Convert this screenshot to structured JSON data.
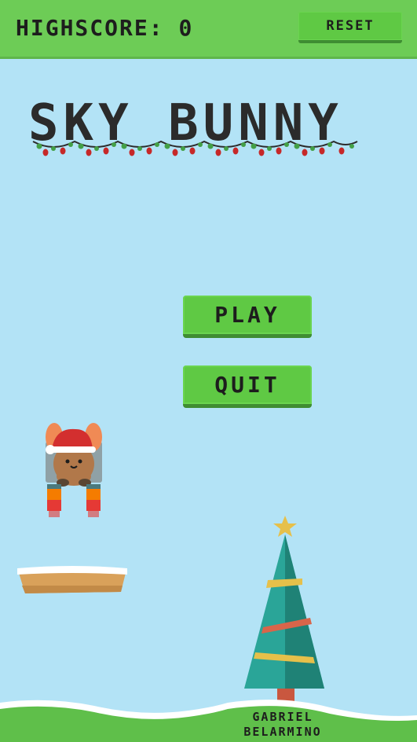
{
  "header": {
    "highscore_label": "HIGHSCORE:",
    "highscore_value": "0",
    "reset_label": "RESET"
  },
  "title": "SKY BUNNY",
  "menu": {
    "play_label": "PLAY",
    "quit_label": "QUIT"
  },
  "credit": {
    "line1": "GABRIEL",
    "line2": "BELARMINO"
  },
  "colors": {
    "sky": "#b3e3f6",
    "bar_green": "#6dcc56",
    "button_green": "#5fc944",
    "button_shadow": "#3f8d32",
    "text_dark": "#1d1d1d",
    "tree_teal": "#2aa598",
    "platform_brown": "#d9a15a",
    "snow": "#ffffff"
  },
  "icons": {
    "player": "bunny-with-santa-hat",
    "decoration": "christmas-lights",
    "scenery": "christmas-tree"
  }
}
